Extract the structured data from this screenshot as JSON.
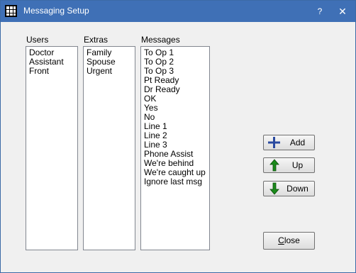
{
  "window": {
    "title": "Messaging Setup",
    "help_label": "?",
    "close_label": "✕"
  },
  "users": {
    "label": "Users",
    "items": [
      "Doctor",
      "Assistant",
      "Front"
    ]
  },
  "extras": {
    "label": "Extras",
    "items": [
      "Family",
      "Spouse",
      "Urgent"
    ]
  },
  "messages": {
    "label": "Messages",
    "items": [
      "To Op 1",
      "To Op 2",
      "To Op 3",
      "Pt Ready",
      "Dr Ready",
      "OK",
      "Yes",
      "No",
      "Line 1",
      "Line 2",
      "Line 3",
      "Phone Assist",
      "We're behind",
      "We're caught up",
      "Ignore last msg"
    ]
  },
  "buttons": {
    "add": {
      "label": "Add",
      "icon": "plus-icon"
    },
    "up": {
      "label": "Up",
      "icon": "arrow-up-icon"
    },
    "down": {
      "label": "Down",
      "icon": "arrow-down-icon"
    },
    "close": {
      "label_first": "C",
      "label_rest": "lose"
    }
  },
  "colors": {
    "titlebar": "#3f70b6",
    "plus": "#2a4aa0",
    "arrow": "#1a8a1a"
  }
}
